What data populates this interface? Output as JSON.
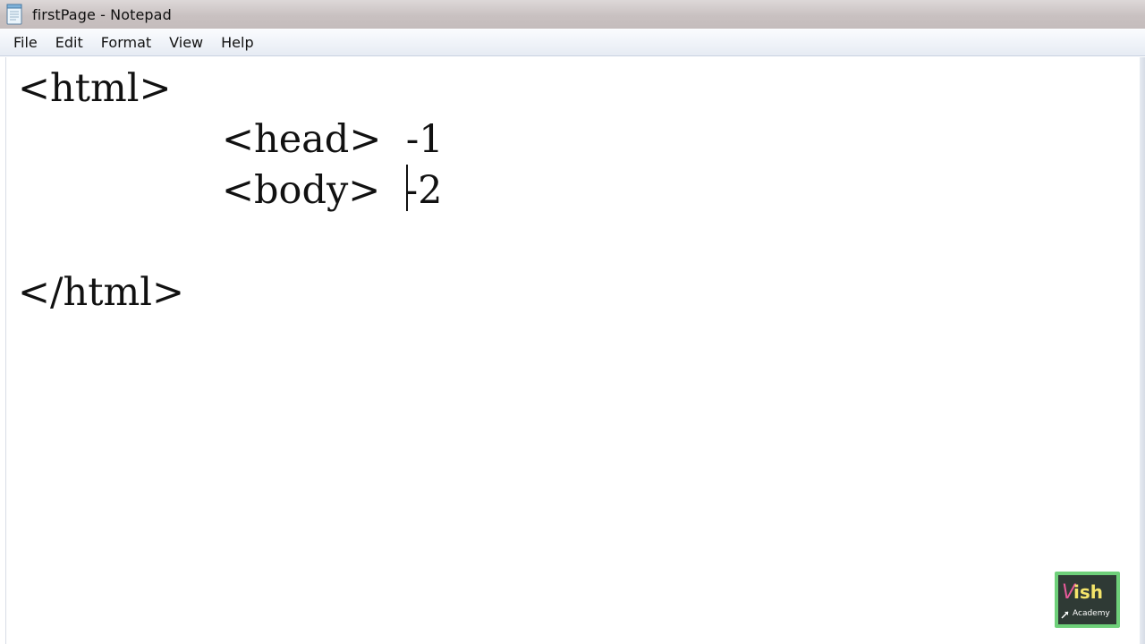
{
  "window": {
    "title": "firstPage - Notepad",
    "app_icon": "notepad-icon"
  },
  "menu": {
    "items": [
      {
        "label": "File"
      },
      {
        "label": "Edit"
      },
      {
        "label": "Format"
      },
      {
        "label": "View"
      },
      {
        "label": "Help"
      }
    ]
  },
  "editor": {
    "lines": [
      "<html>",
      "<head>  -1",
      "<body>  -2",
      "</html>"
    ]
  },
  "watermark": {
    "brand": "Vish",
    "tagline": "Academy",
    "logo": "vish-academy-logo"
  }
}
